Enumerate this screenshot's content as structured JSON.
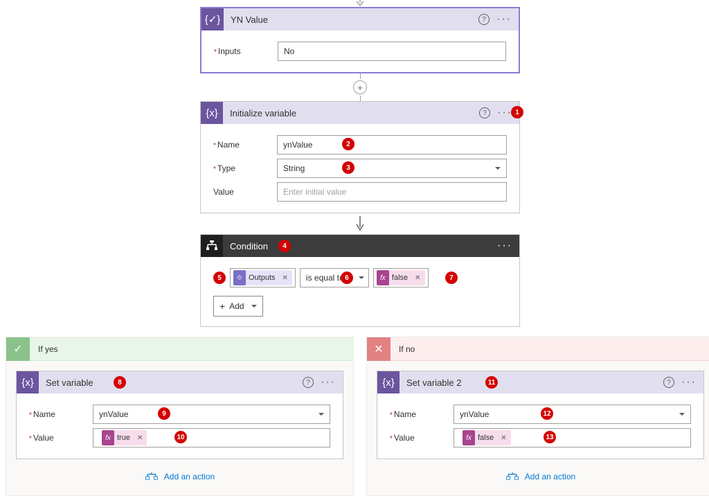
{
  "ynValueCard": {
    "title": "YN Value",
    "inputsLabel": "Inputs",
    "inputsValue": "No"
  },
  "initVar": {
    "title": "Initialize variable",
    "nameLabel": "Name",
    "nameValue": "ynValue",
    "typeLabel": "Type",
    "typeValue": "String",
    "valueLabel": "Value",
    "valuePlaceholder": "Enter initial value"
  },
  "condition": {
    "title": "Condition",
    "leftToken": "Outputs",
    "operator": "is equal to",
    "rightToken": "false",
    "addBtn": "Add"
  },
  "branches": {
    "yes": {
      "title": "If yes",
      "card": {
        "title": "Set variable",
        "nameLabel": "Name",
        "nameValue": "ynValue",
        "valueLabel": "Value",
        "valueToken": "true"
      },
      "addAction": "Add an action"
    },
    "no": {
      "title": "If no",
      "card": {
        "title": "Set variable 2",
        "nameLabel": "Name",
        "nameValue": "ynValue",
        "valueLabel": "Value",
        "valueToken": "false"
      },
      "addAction": "Add an action"
    }
  },
  "annotations": {
    "b1": "1",
    "b2": "2",
    "b3": "3",
    "b4": "4",
    "b5": "5",
    "b6": "6",
    "b7": "7",
    "b8": "8",
    "b9": "9",
    "b10": "10",
    "b11": "11",
    "b12": "12",
    "b13": "13"
  }
}
